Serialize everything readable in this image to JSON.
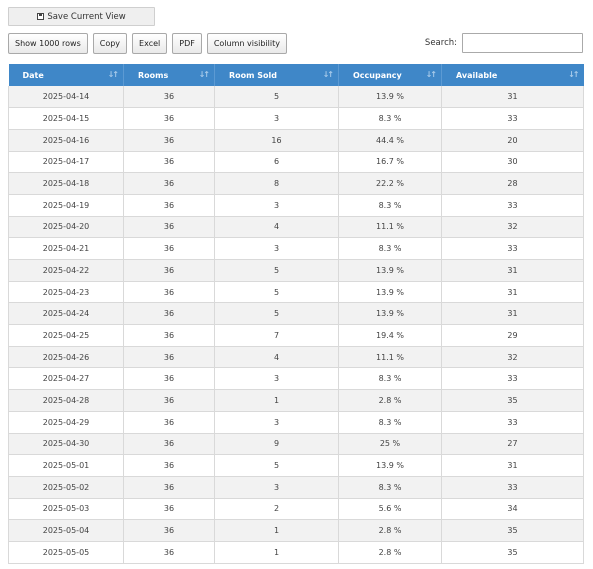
{
  "save_view": {
    "label": "Save Current View"
  },
  "toolbar": {
    "show_rows_label": "Show 1000 rows",
    "copy_label": "Copy",
    "excel_label": "Excel",
    "pdf_label": "PDF",
    "column_visibility_label": "Column visibility"
  },
  "search": {
    "label": "Search:",
    "value": ""
  },
  "table": {
    "headers": [
      "Date",
      "Rooms",
      "Room Sold",
      "Occupancy",
      "Available"
    ],
    "rows": [
      [
        "2025-04-14",
        "36",
        "5",
        "13.9 %",
        "31"
      ],
      [
        "2025-04-15",
        "36",
        "3",
        "8.3 %",
        "33"
      ],
      [
        "2025-04-16",
        "36",
        "16",
        "44.4 %",
        "20"
      ],
      [
        "2025-04-17",
        "36",
        "6",
        "16.7 %",
        "30"
      ],
      [
        "2025-04-18",
        "36",
        "8",
        "22.2 %",
        "28"
      ],
      [
        "2025-04-19",
        "36",
        "3",
        "8.3 %",
        "33"
      ],
      [
        "2025-04-20",
        "36",
        "4",
        "11.1 %",
        "32"
      ],
      [
        "2025-04-21",
        "36",
        "3",
        "8.3 %",
        "33"
      ],
      [
        "2025-04-22",
        "36",
        "5",
        "13.9 %",
        "31"
      ],
      [
        "2025-04-23",
        "36",
        "5",
        "13.9 %",
        "31"
      ],
      [
        "2025-04-24",
        "36",
        "5",
        "13.9 %",
        "31"
      ],
      [
        "2025-04-25",
        "36",
        "7",
        "19.4 %",
        "29"
      ],
      [
        "2025-04-26",
        "36",
        "4",
        "11.1 %",
        "32"
      ],
      [
        "2025-04-27",
        "36",
        "3",
        "8.3 %",
        "33"
      ],
      [
        "2025-04-28",
        "36",
        "1",
        "2.8 %",
        "35"
      ],
      [
        "2025-04-29",
        "36",
        "3",
        "8.3 %",
        "33"
      ],
      [
        "2025-04-30",
        "36",
        "9",
        "25 %",
        "27"
      ],
      [
        "2025-05-01",
        "36",
        "5",
        "13.9 %",
        "31"
      ],
      [
        "2025-05-02",
        "36",
        "3",
        "8.3 %",
        "33"
      ],
      [
        "2025-05-03",
        "36",
        "2",
        "5.6 %",
        "34"
      ],
      [
        "2025-05-04",
        "36",
        "1",
        "2.8 %",
        "35"
      ],
      [
        "2025-05-05",
        "36",
        "1",
        "2.8 %",
        "35"
      ]
    ]
  }
}
